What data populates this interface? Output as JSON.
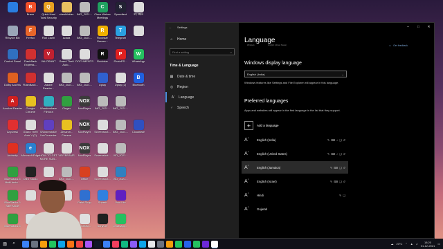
{
  "desktop": {
    "icons": [
      {
        "label": "",
        "color": "#2a7de1",
        "glyph": "",
        "col": 0,
        "row": 0
      },
      {
        "label": "Brave",
        "color": "#f0502a",
        "glyph": "B",
        "col": 1,
        "row": 0
      },
      {
        "label": "Quick Heal Total Security",
        "color": "#e8a020",
        "glyph": "Q",
        "col": 2,
        "row": 0
      },
      {
        "label": "sheshfolder",
        "color": "#e8c060",
        "glyph": "",
        "col": 3,
        "row": 0
      },
      {
        "label": "IMG_2021...",
        "color": "#bbbbbb",
        "glyph": "",
        "col": 4,
        "row": 0
      },
      {
        "label": "Cisco Webex Meetings",
        "color": "#20a060",
        "glyph": "C",
        "col": 5,
        "row": 0
      },
      {
        "label": "Speedtest",
        "color": "#222233",
        "glyph": "S",
        "col": 6,
        "row": 0
      },
      {
        "label": "नए निर्देश",
        "color": "#dddddd",
        "glyph": "",
        "col": 7,
        "row": 0
      },
      {
        "label": "Recycle Bin",
        "color": "#9aa6b8",
        "glyph": "",
        "col": 0,
        "row": 1
      },
      {
        "label": "Firefox",
        "color": "#e8662a",
        "glyph": "F",
        "col": 1,
        "row": 1
      },
      {
        "label": "Roll Claim",
        "color": "#dddddd",
        "glyph": "",
        "col": 2,
        "row": 1
      },
      {
        "label": "Adata",
        "color": "#dddddd",
        "glyph": "",
        "col": 3,
        "row": 1
      },
      {
        "label": "IMG_2021...",
        "color": "#bbbbbb",
        "glyph": "",
        "col": 4,
        "row": 1
      },
      {
        "label": "Rockstar Games...",
        "color": "#f0b000",
        "glyph": "R",
        "col": 5,
        "row": 1
      },
      {
        "label": "Telegram",
        "color": "#2aa0e0",
        "glyph": "T",
        "col": 6,
        "row": 1
      },
      {
        "label": "",
        "color": "#dddddd",
        "glyph": "",
        "col": 7,
        "row": 1
      },
      {
        "label": "Control Panel",
        "color": "#3070c0",
        "glyph": "",
        "col": 0,
        "row": 2
      },
      {
        "label": "FlashBack Express...",
        "color": "#d03030",
        "glyph": "",
        "col": 1,
        "row": 2
      },
      {
        "label": "VALORANT",
        "color": "#c02030",
        "glyph": "V",
        "col": 2,
        "row": 2
      },
      {
        "label": "Grand Theft Auto...",
        "color": "#dddddd",
        "glyph": "",
        "col": 3,
        "row": 2
      },
      {
        "label": "DOCUMENTS",
        "color": "#dddddd",
        "glyph": "",
        "col": 4,
        "row": 2
      },
      {
        "label": "Rockstar",
        "color": "#111111",
        "glyph": "R",
        "col": 5,
        "row": 2
      },
      {
        "label": "PhotoPS...",
        "color": "#e02020",
        "glyph": "P",
        "col": 6,
        "row": 2
      },
      {
        "label": "WhatsApp",
        "color": "#25c060",
        "glyph": "W",
        "col": 7,
        "row": 2
      },
      {
        "label": "Dolby Access",
        "color": "#e06020",
        "glyph": "",
        "col": 0,
        "row": 3
      },
      {
        "label": "FlashBack...",
        "color": "#d03030",
        "glyph": "",
        "col": 1,
        "row": 3
      },
      {
        "label": "Adobe Reader...",
        "color": "#dddddd",
        "glyph": "",
        "col": 2,
        "row": 3
      },
      {
        "label": "IMG_2021...",
        "color": "#bbbbbb",
        "glyph": "",
        "col": 3,
        "row": 3
      },
      {
        "label": "IMG_2021...",
        "color": "#bbbbbb",
        "glyph": "",
        "col": 4,
        "row": 3
      },
      {
        "label": "Uplay",
        "color": "#3060d0",
        "glyph": "",
        "col": 5,
        "row": 3
      },
      {
        "label": "Uplay (2)",
        "color": "#dddddd",
        "glyph": "",
        "col": 6,
        "row": 3
      },
      {
        "label": "Bluetooth",
        "color": "#2060e0",
        "glyph": "B",
        "col": 7,
        "row": 3
      },
      {
        "label": "Acrobat Reader",
        "color": "#d02020",
        "glyph": "A",
        "col": 0,
        "row": 4
      },
      {
        "label": "Google Chrome",
        "color": "#e8c020",
        "glyph": "",
        "col": 1,
        "row": 4
      },
      {
        "label": "Wondershare Filmora",
        "color": "#30b0c0",
        "glyph": "",
        "col": 2,
        "row": 4
      },
      {
        "label": "Ginger",
        "color": "#30a040",
        "glyph": "",
        "col": 3,
        "row": 4
      },
      {
        "label": "NoxPlayer",
        "color": "#3b3b3b",
        "glyph": "NOX",
        "col": 4,
        "row": 4
      },
      {
        "label": "IMG_2021...",
        "color": "#bbbbbb",
        "glyph": "",
        "col": 5,
        "row": 4
      },
      {
        "label": "IMG_2021...",
        "color": "#bbbbbb",
        "glyph": "",
        "col": 6,
        "row": 4
      },
      {
        "label": "AnyDesk",
        "color": "#e03030",
        "glyph": "",
        "col": 0,
        "row": 5
      },
      {
        "label": "Grand Theft Auto V (2)",
        "color": "#dddddd",
        "glyph": "",
        "col": 1,
        "row": 5
      },
      {
        "label": "Wondershare UniConverter",
        "color": "#6040c0",
        "glyph": "",
        "col": 2,
        "row": 5
      },
      {
        "label": "Zenarch - Chrome",
        "color": "#e8c020",
        "glyph": "",
        "col": 3,
        "row": 5
      },
      {
        "label": "NoxPlayer",
        "color": "#3b3b3b",
        "glyph": "NOX",
        "col": 4,
        "row": 5
      },
      {
        "label": "Screenshot...",
        "color": "#dddddd",
        "glyph": "",
        "col": 5,
        "row": 5
      },
      {
        "label": "IMG_2021...",
        "color": "#bbbbbb",
        "glyph": "",
        "col": 6,
        "row": 5
      },
      {
        "label": "Cloudflare",
        "color": "#3050c0",
        "glyph": "",
        "col": 7,
        "row": 5
      },
      {
        "label": "Audacity",
        "color": "#e03020",
        "glyph": "",
        "col": 0,
        "row": 6
      },
      {
        "label": "Microsoft Edge",
        "color": "#2a80d0",
        "glyph": "e",
        "col": 1,
        "row": 6
      },
      {
        "label": "HOW TO GET MORE SUB...",
        "color": "#dddddd",
        "glyph": "",
        "col": 2,
        "row": 6
      },
      {
        "label": "VIDYBEAMS",
        "color": "#dddddd",
        "glyph": "",
        "col": 3,
        "row": 6
      },
      {
        "label": "NoxPlayer",
        "color": "#3b3b3b",
        "glyph": "NOX",
        "col": 4,
        "row": 6
      },
      {
        "label": "Screenshot...",
        "color": "#dddddd",
        "glyph": "",
        "col": 5,
        "row": 6
      },
      {
        "label": "VID_2021...",
        "color": "#bbbbbb",
        "glyph": "",
        "col": 6,
        "row": 6
      },
      {
        "label": "BlueStacks 5 Multi-Insta...",
        "color": "#30a040",
        "glyph": "",
        "col": 0,
        "row": 7
      },
      {
        "label": "OBS Studio",
        "color": "#222222",
        "glyph": "",
        "col": 1,
        "row": 7
      },
      {
        "label": "",
        "color": "#dddddd",
        "glyph": "",
        "col": 2,
        "row": 7
      },
      {
        "label": "IMG_2021...",
        "color": "#bbbbbb",
        "glyph": "",
        "col": 3,
        "row": 7
      },
      {
        "label": "Office",
        "color": "#d84020",
        "glyph": "",
        "col": 4,
        "row": 7
      },
      {
        "label": "Screenshot...",
        "color": "#dddddd",
        "glyph": "",
        "col": 5,
        "row": 7
      },
      {
        "label": "VID_2021...",
        "color": "#3080c0",
        "glyph": "",
        "col": 6,
        "row": 7
      },
      {
        "label": "BlueStacks 5 Safe Mode",
        "color": "#30a040",
        "glyph": "",
        "col": 0,
        "row": 8
      },
      {
        "label": "",
        "color": "#dddddd",
        "glyph": "",
        "col": 1,
        "row": 8
      },
      {
        "label": "",
        "color": "#dddddd",
        "glyph": "",
        "col": 2,
        "row": 8
      },
      {
        "label": "",
        "color": "#dddddd",
        "glyph": "",
        "col": 3,
        "row": 8
      },
      {
        "label": "Paint Shop",
        "color": "#3070d0",
        "glyph": "",
        "col": 4,
        "row": 8
      },
      {
        "label": "Shareit",
        "color": "#3080e0",
        "glyph": "",
        "col": 5,
        "row": 8
      },
      {
        "label": "Voot Lite",
        "color": "#6020c0",
        "glyph": "",
        "col": 6,
        "row": 8
      },
      {
        "label": "BlueStacks 5",
        "color": "#30a040",
        "glyph": "",
        "col": 0,
        "row": 9
      },
      {
        "label": "",
        "color": "#dddddd",
        "glyph": "",
        "col": 1,
        "row": 9
      },
      {
        "label": "",
        "color": "#dddddd",
        "glyph": "",
        "col": 2,
        "row": 9
      },
      {
        "label": "",
        "color": "#dddddd",
        "glyph": "",
        "col": 3,
        "row": 9
      },
      {
        "label": "HTC5084...",
        "color": "#e0e0e0",
        "glyph": "",
        "col": 4,
        "row": 9
      },
      {
        "label": "SonyLIV",
        "color": "#202020",
        "glyph": "",
        "col": 5,
        "row": 9
      },
      {
        "label": "whatsapp...",
        "color": "#25c060",
        "glyph": "",
        "col": 6,
        "row": 9
      }
    ]
  },
  "settings": {
    "window_title": "Settings",
    "sidebar": {
      "home": "Home",
      "search_placeholder": "Find a setting",
      "section": "Time & Language",
      "items": [
        {
          "label": "Date & time",
          "icon": "calendar-icon",
          "glyph": "▦"
        },
        {
          "label": "Region",
          "icon": "globe-icon",
          "glyph": "◎"
        },
        {
          "label": "Language",
          "icon": "language-icon",
          "glyph": "Aʼ",
          "active": true
        },
        {
          "label": "Speech",
          "icon": "microphone-icon",
          "glyph": "♂"
        }
      ]
    },
    "main": {
      "page_title": "Language",
      "sub_left": "Windows",
      "sub_mid": "English (United States)",
      "help_link": "Get feedback",
      "display_language_heading": "Windows display language",
      "display_language_value": "English (India)",
      "display_language_desc": "Windows features like Settings and File Explorer will appear in this language.",
      "preferred_heading": "Preferred languages",
      "preferred_desc": "Apps and websites will appear in the first language in the list that they support.",
      "add_language": "Add a language",
      "languages": [
        {
          "name": "English (India)",
          "features": [
            "✎",
            "⌨",
            "♪",
            "❑",
            "↺"
          ]
        },
        {
          "name": "English (United States)",
          "features": [
            "✎",
            "⌨",
            "♪",
            "❑",
            "↺"
          ]
        },
        {
          "name": "English (Jamaica)",
          "features": [
            "✎",
            "⌨",
            "❑",
            "↺"
          ],
          "selected": true
        },
        {
          "name": "English (Israel)",
          "features": [
            "✎",
            "⌨",
            "❑",
            "↺"
          ]
        },
        {
          "name": "Hindi",
          "features": [
            "✎",
            "❑"
          ]
        },
        {
          "name": "Gujarati",
          "features": []
        }
      ]
    }
  },
  "taskbar": {
    "apps": [
      "#3b82f6",
      "#6b7280",
      "#f59e0b",
      "#22c55e",
      "#0ea5e9",
      "#f97316",
      "#ef4444",
      "#a855f7",
      "#111827",
      "#3b82f6",
      "#f43f5e",
      "#10b981",
      "#8b5cf6",
      "#0ea5e9",
      "#e5e7eb",
      "#6b7280",
      "#f59e0b",
      "#22c55e",
      "#2563eb",
      "#25c060",
      "#6d28d9",
      "#ffffff"
    ],
    "temperature": "23°C",
    "time": "18:20",
    "date": "01-12-2021"
  }
}
